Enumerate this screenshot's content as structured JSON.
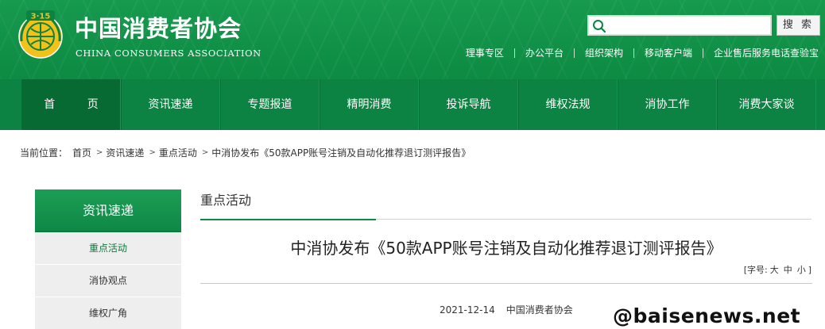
{
  "header": {
    "brand_cn": "中国消费者协会",
    "brand_en": "CHINA CONSUMERS ASSOCIATION",
    "logo_text": "3·15",
    "search": {
      "placeholder": "",
      "value": "",
      "button_label": "搜 索"
    },
    "top_links": [
      "理事专区",
      "办公平台",
      "组织架构",
      "移动客户端",
      "企业售后服务电话查验宝"
    ]
  },
  "nav": {
    "items": [
      "首 页",
      "资讯速递",
      "专题报道",
      "精明消费",
      "投诉导航",
      "维权法规",
      "消协工作",
      "消费大家谈"
    ]
  },
  "breadcrumb": {
    "prefix": "当前位置：",
    "items": [
      "首页",
      "资讯速递",
      "重点活动",
      "中消协发布《50款APP账号注销及自动化推荐退订测评报告》"
    ]
  },
  "sidebar": {
    "title": "资讯速递",
    "items": [
      {
        "label": "重点活动",
        "active": true
      },
      {
        "label": "消协观点",
        "active": false
      },
      {
        "label": "维权广角",
        "active": false
      }
    ]
  },
  "content": {
    "section_title": "重点活动",
    "article_title": "中消协发布《50款APP账号注销及自动化推荐退订测评报告》",
    "font_size": {
      "label": "[字号:",
      "large": "大",
      "medium": "中",
      "small": "小",
      "close": "]"
    },
    "meta": {
      "date": "2021-12-14",
      "source": "中国消费者协会"
    }
  },
  "watermark": "@baisenews.net",
  "colors": {
    "brand_green": "#0c8342",
    "header_green": "#169a4e",
    "active_green": "#0b7a3c"
  }
}
